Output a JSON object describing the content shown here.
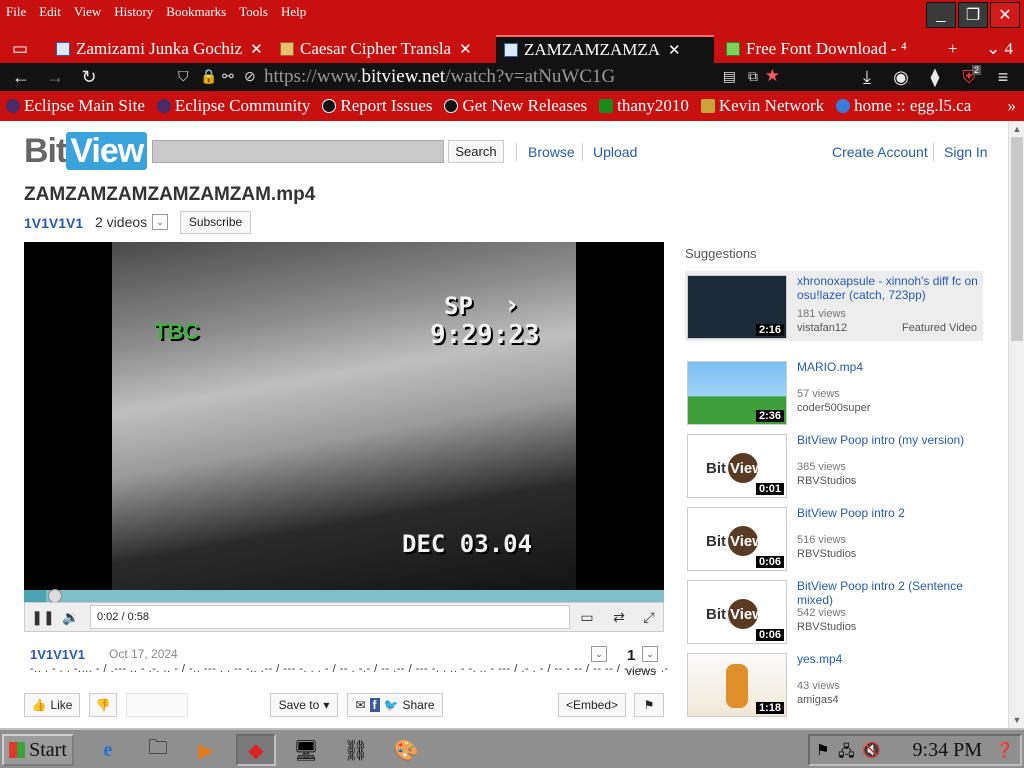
{
  "browser": {
    "menu": [
      "File",
      "Edit",
      "View",
      "History",
      "Bookmarks",
      "Tools",
      "Help"
    ],
    "tabs": [
      {
        "label": "Zamizami Junka Gochiz",
        "active": false
      },
      {
        "label": "Caesar Cipher Transla",
        "active": false
      },
      {
        "label": "ZAMZAMZAMZA",
        "active": true
      },
      {
        "label": "Free Font Download - ⁴",
        "active": false
      }
    ],
    "url_prefix": "https://www.",
    "url_domain": "bitview.net",
    "url_rest": "/watch?v=atNuWC1G",
    "bookmarks": [
      "Eclipse Main Site",
      "Eclipse Community",
      "Report Issues",
      "Get New Releases",
      "thany2010",
      "Kevin Network",
      "home :: egg.l5.ca"
    ],
    "ext_badge": "2"
  },
  "site": {
    "logo_bit": "Bit",
    "logo_view": "View",
    "search_button": "Search",
    "browse": "Browse",
    "upload": "Upload",
    "create_account": "Create Account",
    "sign_in": "Sign In"
  },
  "video": {
    "title": "ZAMZAMZAMZAMZAMZAM.mp4",
    "channel": "1V1V1V1",
    "video_count": "2 videos",
    "subscribe": "Subscribe",
    "osd_sp": "SP",
    "osd_time": "9:29:23",
    "osd_tbc": "TBC",
    "osd_date": "DEC 03.04",
    "time_display": "0:02 / 0:58",
    "progress_fraction": 0.034,
    "upload_date": "Oct 17, 2024",
    "description": "-.. . - . . -.... - / .--- .. - .-. .. - / -.. --- . . -- -.. .-- / --- -. . . - / -- . -.- / -- .-- / --- -. . .. - -. .. - --- / .- . - / -- - -- / -- -- / -.. -.. . .-",
    "views_count": "1",
    "views_label": "views",
    "like": "Like",
    "save_to": "Save to",
    "share": "Share",
    "embed": "<Embed>"
  },
  "suggestions": {
    "heading": "Suggestions",
    "items": [
      {
        "title": "xhronoxapsule - xinnoh's diff fc on osu!lazer (catch, 723pp)",
        "views": "181 views",
        "by": "vistafan12",
        "duration": "2:16",
        "featured": "Featured Video"
      },
      {
        "title": "MARIO.mp4",
        "views": "57 views",
        "by": "coder500super",
        "duration": "2:36"
      },
      {
        "title": "BitView Poop intro (my version)",
        "views": "385 views",
        "by": "RBVStudios",
        "duration": "0:01"
      },
      {
        "title": "BitView Poop intro 2",
        "views": "516 views",
        "by": "RBVStudios",
        "duration": "0:06"
      },
      {
        "title": "BitView Poop intro 2 (Sentence mixed)",
        "views": "542 views",
        "by": "RBVStudios",
        "duration": "0:06"
      },
      {
        "title": "yes.mp4",
        "views": "43 views",
        "by": "amigas4",
        "duration": "1:18"
      }
    ]
  },
  "taskbar": {
    "start": "Start",
    "clock": "9:34 PM"
  }
}
